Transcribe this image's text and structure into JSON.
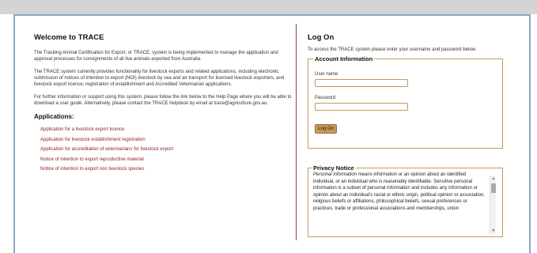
{
  "welcome": {
    "title": "Welcome to TRACE",
    "paragraphs": [
      "The Tracking Animal Certification for Export, or TRACE, system is being implemented to manage the application and approval processes for consignments of all live animals exported from Australia.",
      "The TRACE system currently provides functionality for livestock exports and related applications, including electronic submission of notices of intention to export (NOI) livestock by sea and air transport for licensed livestock exporters, and livestock export licence, registration of establishment and Accredited Veterinarian applications.",
      "For further information or support using this system, please follow the link below to the Help Page where you will be able to download a user guide. Alternatively, please contact the TRACE helpdesk by email at trace@agriculture.gov.au."
    ]
  },
  "applications": {
    "title": "Applications:",
    "items": [
      "Application for a livestock export licence",
      "Application for livestock establishment registration",
      "Application for accreditation of veterinarians for livestock export",
      "Notice of intention to export reproductive material",
      "Notice of intention to export non livestock species"
    ]
  },
  "logon": {
    "title": "Log On",
    "intro": "To access the TRACE system please enter your username and password below.",
    "account_legend": "Account Information",
    "username_label": "User name",
    "username_value": "",
    "password_label": "Password",
    "password_value": "",
    "button_label": "Log On"
  },
  "privacy": {
    "legend": "Privacy Notice",
    "text_lead": "Personal information",
    "text_rest": " means information or an opinion about an identified individual, or an individual who is reasonably identifiable. Sensitive personal information is a subset of personal information and includes any information or opinion about an individual's racial or ethnic origin, political opinion or association, religious beliefs or affiliations, philosophical beliefs, sexual preferences or practices, trade or professional associations and memberships, union"
  },
  "icons": {
    "scroll_up": "triangle-up",
    "scroll_down": "triangle-down"
  },
  "colors": {
    "link": "#8b1e1e",
    "accent": "#c89a5a",
    "frame_border": "#8ca7c6",
    "divider": "#8a4d4d"
  }
}
